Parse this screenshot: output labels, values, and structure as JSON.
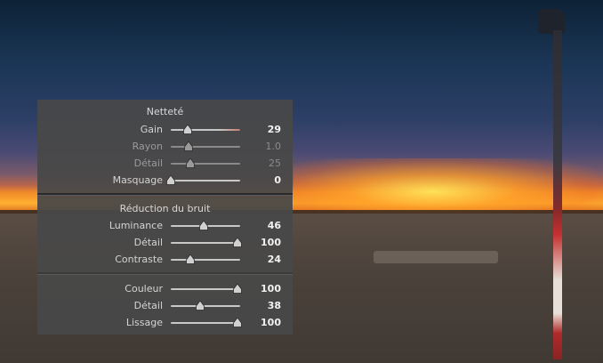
{
  "panel": {
    "sharpening": {
      "title": "Netteté",
      "rows": [
        {
          "label": "Gain",
          "value": "29",
          "fraction": 0.24,
          "dim": false
        },
        {
          "label": "Rayon",
          "value": "1.0",
          "fraction": 0.25,
          "dim": true
        },
        {
          "label": "Détail",
          "value": "25",
          "fraction": 0.28,
          "dim": true
        },
        {
          "label": "Masquage",
          "value": "0",
          "fraction": 0.0,
          "dim": false
        }
      ]
    },
    "noise_reduction": {
      "title": "Réduction du bruit",
      "luminance_rows": [
        {
          "label": "Luminance",
          "value": "46",
          "fraction": 0.48,
          "dim": false
        },
        {
          "label": "Détail",
          "value": "100",
          "fraction": 0.96,
          "dim": false
        },
        {
          "label": "Contraste",
          "value": "24",
          "fraction": 0.28,
          "dim": false
        }
      ],
      "color_rows": [
        {
          "label": "Couleur",
          "value": "100",
          "fraction": 0.96,
          "dim": false
        },
        {
          "label": "Détail",
          "value": "38",
          "fraction": 0.42,
          "dim": false
        },
        {
          "label": "Lissage",
          "value": "100",
          "fraction": 0.96,
          "dim": false
        }
      ]
    }
  },
  "colors": {
    "panel_bg": "#484848",
    "track": "#c8c8c8",
    "gain_track_end": "#c87a6e"
  }
}
